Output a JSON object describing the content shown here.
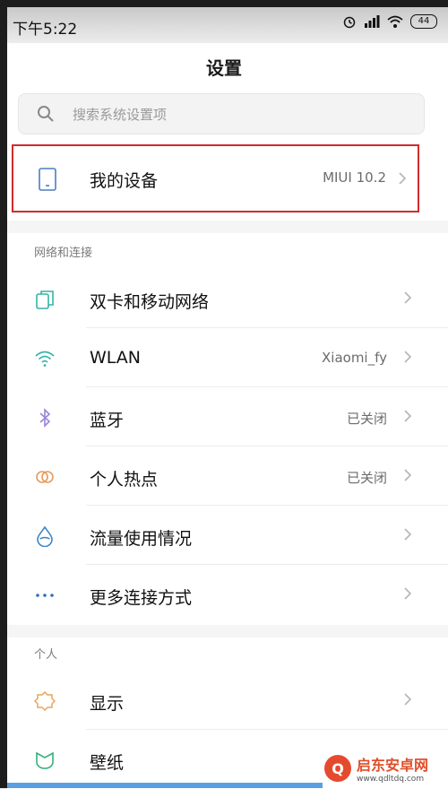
{
  "status": {
    "time": "下午5:22",
    "battery": "44"
  },
  "header": {
    "title": "设置"
  },
  "search": {
    "placeholder": "搜索系统设置项"
  },
  "device": {
    "label": "我的设备",
    "value": "MIUI 10.2"
  },
  "sections": {
    "network": "网络和连接",
    "personal": "个人"
  },
  "network_items": [
    {
      "label": "双卡和移动网络",
      "value": ""
    },
    {
      "label": "WLAN",
      "value": "Xiaomi_fy"
    },
    {
      "label": "蓝牙",
      "value": "已关闭"
    },
    {
      "label": "个人热点",
      "value": "已关闭"
    },
    {
      "label": "流量使用情况",
      "value": ""
    },
    {
      "label": "更多连接方式",
      "value": ""
    }
  ],
  "personal_items": [
    {
      "label": "显示"
    },
    {
      "label": "壁纸"
    }
  ],
  "watermark": {
    "name": "启东安卓网",
    "url": "www.qdltdq.com"
  },
  "colors": {
    "highlight": "#d12b2b",
    "wifi_icon": "#36b3a8",
    "bluetooth_icon": "#9a84d8",
    "hotspot_icon": "#e79a5a",
    "data_icon": "#3b86c8",
    "more_icon": "#2e6fb8",
    "display_icon": "#e8a55a",
    "wallpaper_icon": "#35b07b"
  }
}
